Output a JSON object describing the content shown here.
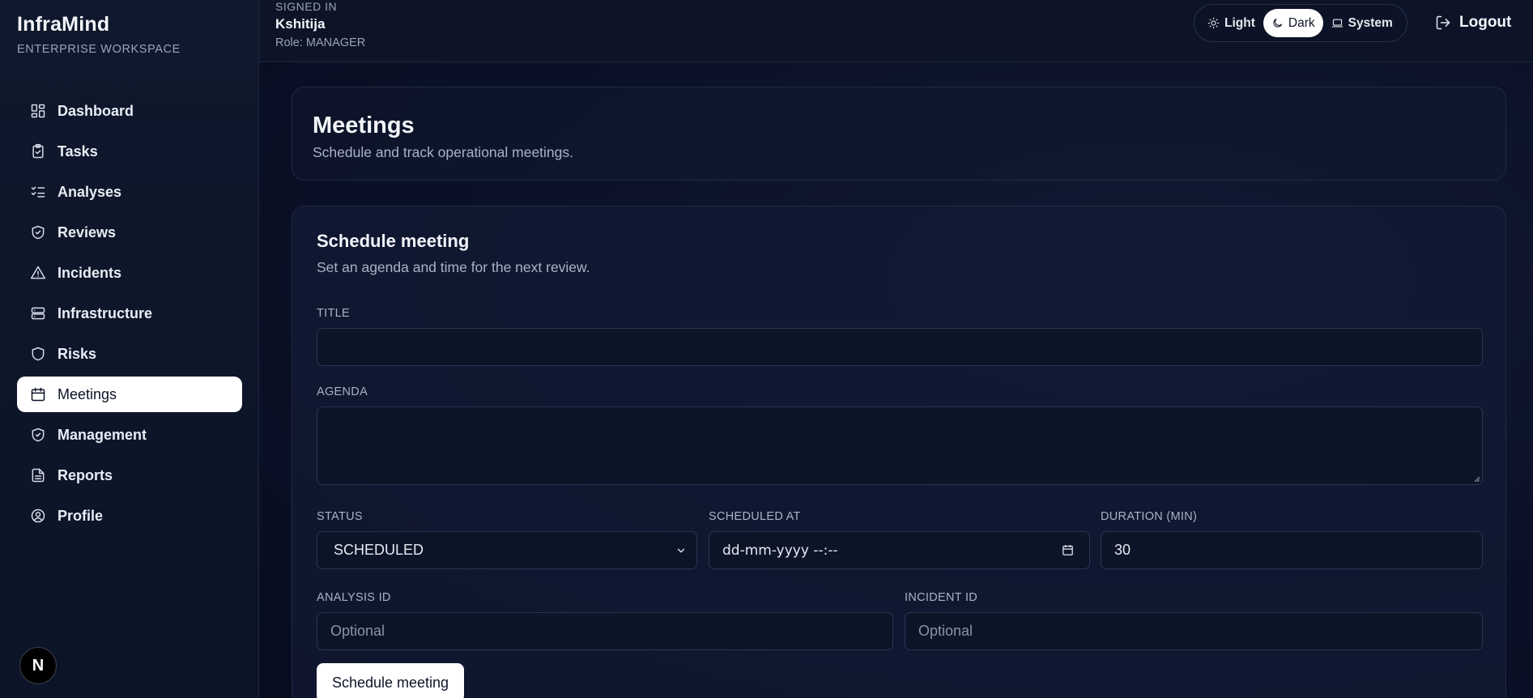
{
  "brand": {
    "name": "InfraMind",
    "subtitle": "ENTERPRISE WORKSPACE"
  },
  "sidebar": {
    "items": [
      {
        "label": "Dashboard",
        "icon": "dashboard-icon",
        "active": false
      },
      {
        "label": "Tasks",
        "icon": "clipboard-check-icon",
        "active": false
      },
      {
        "label": "Analyses",
        "icon": "list-checks-icon",
        "active": false
      },
      {
        "label": "Reviews",
        "icon": "shield-check-icon",
        "active": false
      },
      {
        "label": "Incidents",
        "icon": "alert-triangle-icon",
        "active": false
      },
      {
        "label": "Infrastructure",
        "icon": "server-icon",
        "active": false
      },
      {
        "label": "Risks",
        "icon": "shield-icon",
        "active": false
      },
      {
        "label": "Meetings",
        "icon": "calendar-icon",
        "active": true
      },
      {
        "label": "Management",
        "icon": "shield-check-icon",
        "active": false
      },
      {
        "label": "Reports",
        "icon": "file-text-icon",
        "active": false
      },
      {
        "label": "Profile",
        "icon": "user-circle-icon",
        "active": false
      }
    ],
    "badge": "N"
  },
  "header": {
    "signed_in_label": "SIGNED IN",
    "user_name": "Kshitija",
    "role": "Role: MANAGER",
    "theme": {
      "light": "Light",
      "dark": "Dark",
      "system": "System",
      "selected": "Dark"
    },
    "logout_label": "Logout"
  },
  "page": {
    "title": "Meetings",
    "subtitle": "Schedule and track operational meetings."
  },
  "form": {
    "title": "Schedule meeting",
    "subtitle": "Set an agenda and time for the next review.",
    "title_label": "TITLE",
    "title_value": "",
    "agenda_label": "AGENDA",
    "agenda_value": "",
    "status_label": "STATUS",
    "status_value": "SCHEDULED",
    "scheduled_at_label": "SCHEDULED AT",
    "scheduled_at_value": "dd-mm-yyyy --:--",
    "duration_label": "DURATION (MIN)",
    "duration_value": "30",
    "analysis_id_label": "ANALYSIS ID",
    "analysis_id_placeholder": "Optional",
    "incident_id_label": "INCIDENT ID",
    "incident_id_placeholder": "Optional",
    "submit_label": "Schedule meeting"
  },
  "colors": {
    "background": "#0a1024",
    "sidebar": "#0f182c",
    "accent_active": "#ffffff",
    "text_primary": "#f3f5fa",
    "text_muted": "#aab2c5",
    "border": "#2a3552"
  }
}
